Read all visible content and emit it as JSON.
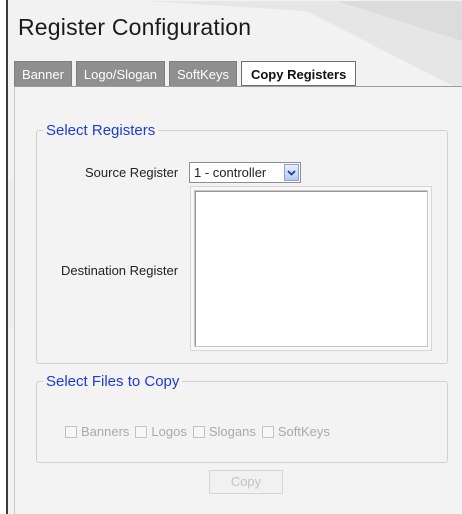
{
  "title": "Register Configuration",
  "tabs": [
    {
      "label": "Banner",
      "active": false
    },
    {
      "label": "Logo/Slogan",
      "active": false
    },
    {
      "label": "SoftKeys",
      "active": false
    },
    {
      "label": "Copy Registers",
      "active": true
    }
  ],
  "select_registers": {
    "legend": "Select Registers",
    "source_label": "Source Register",
    "source_value": "1 - controller",
    "destination_label": "Destination Register",
    "destination_items": []
  },
  "select_files": {
    "legend": "Select Files to Copy",
    "options": [
      {
        "label": "Banners",
        "checked": false,
        "enabled": false
      },
      {
        "label": "Logos",
        "checked": false,
        "enabled": false
      },
      {
        "label": "Slogans",
        "checked": false,
        "enabled": false
      },
      {
        "label": "SoftKeys",
        "checked": false,
        "enabled": false
      }
    ]
  },
  "copy_button": {
    "label": "Copy",
    "enabled": false
  },
  "colors": {
    "legend": "#1f3bd1",
    "tab_inactive": "#8f8f8f",
    "tab_active": "#ffffff",
    "panel_bg": "#f3f3f3"
  },
  "icons": {
    "dropdown": "chevron-down-icon"
  }
}
